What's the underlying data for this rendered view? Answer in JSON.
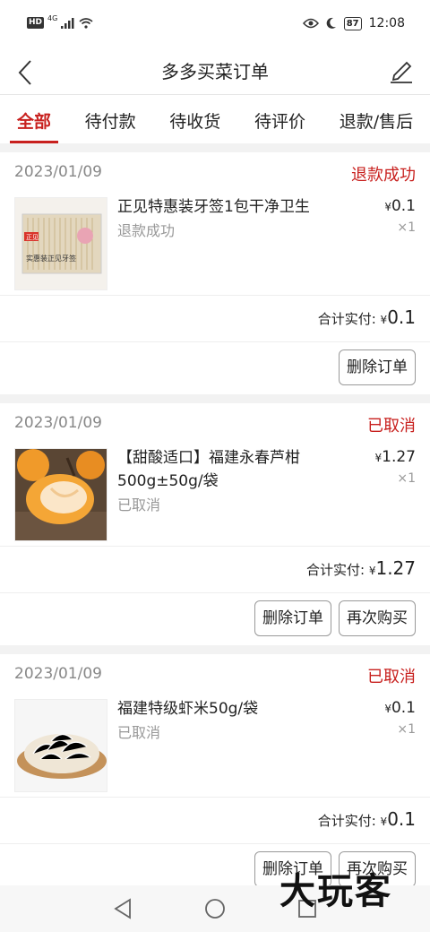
{
  "statusbar": {
    "hd": "HD",
    "network": "4G",
    "battery": "87",
    "time": "12:08"
  },
  "header": {
    "title": "多多买菜订单"
  },
  "tabs": [
    {
      "label": "全部",
      "active": true
    },
    {
      "label": "待付款",
      "active": false
    },
    {
      "label": "待收货",
      "active": false
    },
    {
      "label": "待评价",
      "active": false
    },
    {
      "label": "退款/售后",
      "active": false
    }
  ],
  "orders": [
    {
      "date": "2023/01/09",
      "status": "退款成功",
      "item_name": "正见特惠装牙签1包干净卫生",
      "item_sub": "退款成功",
      "currency": "¥",
      "price": "0.1",
      "qty": "×1",
      "total_label": "合计实付:",
      "total": "0.1",
      "buttons": [
        "删除订单"
      ]
    },
    {
      "date": "2023/01/09",
      "status": "已取消",
      "item_name": "【甜酸适口】福建永春芦柑500g±50g/袋",
      "item_sub": "已取消",
      "currency": "¥",
      "price": "1.27",
      "qty": "×1",
      "total_label": "合计实付:",
      "total": "1.27",
      "buttons": [
        "删除订单",
        "再次购买"
      ]
    },
    {
      "date": "2023/01/09",
      "status": "已取消",
      "item_name": "福建特级虾米50g/袋",
      "item_sub": "已取消",
      "currency": "¥",
      "price": "0.1",
      "qty": "×1",
      "total_label": "合计实付:",
      "total": "0.1",
      "buttons": [
        "删除订单",
        "再次购买"
      ]
    }
  ],
  "thumb_text": {
    "brand": "正见",
    "product": "实惠装正见牙签"
  },
  "watermark": "大玩客",
  "colors": {
    "accent": "#c8201e",
    "muted": "#999999"
  }
}
